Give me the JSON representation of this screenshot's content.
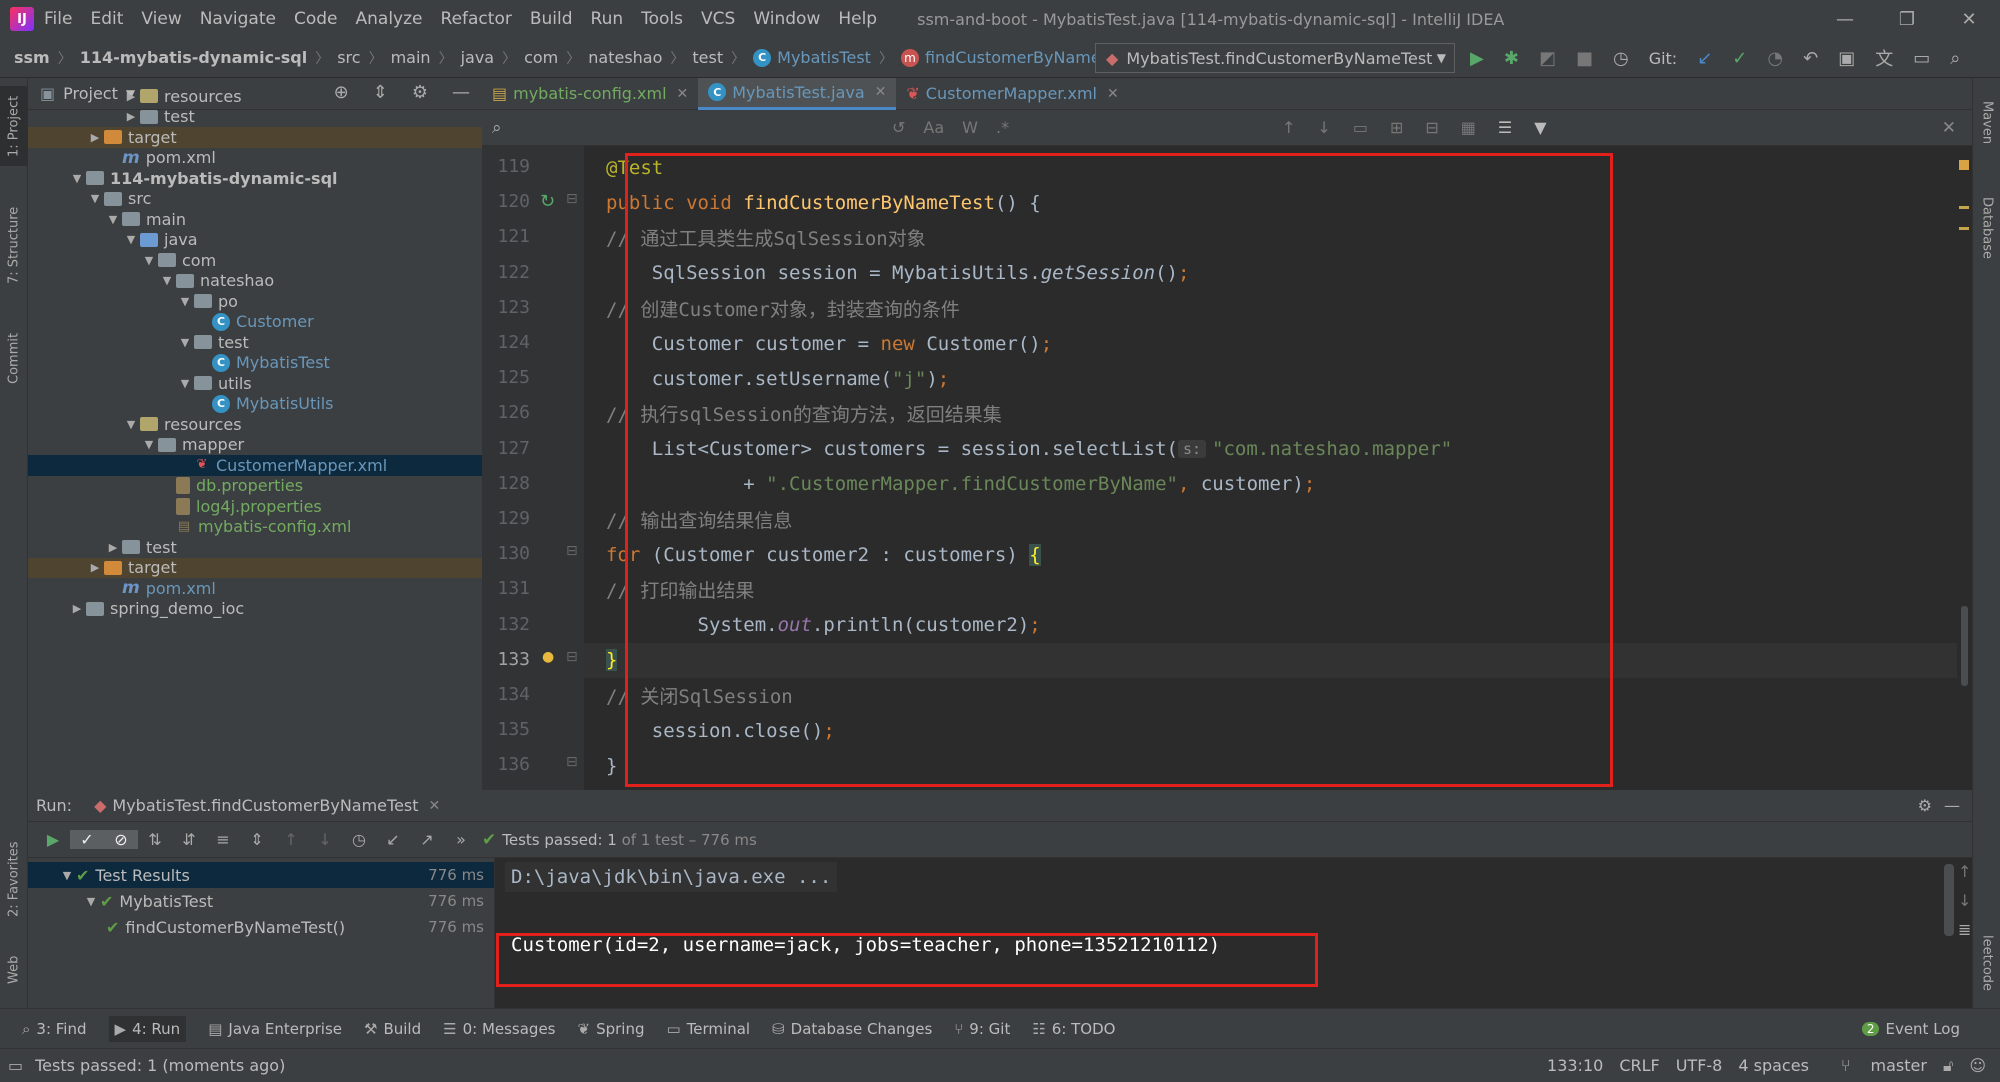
{
  "menubar": {
    "items": [
      "File",
      "Edit",
      "View",
      "Navigate",
      "Code",
      "Analyze",
      "Refactor",
      "Build",
      "Run",
      "Tools",
      "VCS",
      "Window",
      "Help"
    ],
    "title": "ssm-and-boot - MybatisTest.java [114-mybatis-dynamic-sql] - IntelliJ IDEA"
  },
  "breadcrumbs": [
    "ssm",
    "114-mybatis-dynamic-sql",
    "src",
    "main",
    "java",
    "com",
    "nateshao",
    "test",
    "MybatisTest",
    "findCustomerByNameTest"
  ],
  "run_config": "MybatisTest.findCustomerByNameTest",
  "git_label": "Git:",
  "left_tabs": {
    "project": "1: Project",
    "structure": "7: Structure",
    "commit": "Commit",
    "favorites": "2: Favorites",
    "web": "Web"
  },
  "right_tabs": {
    "maven": "Maven",
    "database": "Database",
    "leetcode": "leetcode"
  },
  "project_panel": {
    "title": "Project",
    "tree": [
      {
        "label": "resources",
        "type": "res",
        "indent": 3,
        "arrow": "right"
      },
      {
        "label": "test",
        "type": "pkg",
        "indent": 3,
        "arrow": "right"
      },
      {
        "label": "target",
        "type": "tgt",
        "indent": 1,
        "arrow": "right",
        "hl": true
      },
      {
        "label": "pom.xml",
        "type": "maven",
        "indent": 2,
        "arrow": ""
      },
      {
        "label": "114-mybatis-dynamic-sql",
        "type": "pkg",
        "indent": 0,
        "arrow": "down",
        "bold": true
      },
      {
        "label": "src",
        "type": "pkg",
        "indent": 1,
        "arrow": "down"
      },
      {
        "label": "main",
        "type": "pkg",
        "indent": 2,
        "arrow": "down"
      },
      {
        "label": "java",
        "type": "src",
        "indent": 3,
        "arrow": "down"
      },
      {
        "label": "com",
        "type": "pkg",
        "indent": 4,
        "arrow": "down"
      },
      {
        "label": "nateshao",
        "type": "pkg",
        "indent": 5,
        "arrow": "down"
      },
      {
        "label": "po",
        "type": "pkg",
        "indent": 6,
        "arrow": "down"
      },
      {
        "label": "Customer",
        "type": "class",
        "indent": 7,
        "arrow": ""
      },
      {
        "label": "test",
        "type": "pkg",
        "indent": 6,
        "arrow": "down"
      },
      {
        "label": "MybatisTest",
        "type": "class",
        "indent": 7,
        "arrow": ""
      },
      {
        "label": "utils",
        "type": "pkg",
        "indent": 6,
        "arrow": "down"
      },
      {
        "label": "MybatisUtils",
        "type": "class",
        "indent": 7,
        "arrow": ""
      },
      {
        "label": "resources",
        "type": "res",
        "indent": 3,
        "arrow": "down"
      },
      {
        "label": "mapper",
        "type": "pkg",
        "indent": 4,
        "arrow": "down"
      },
      {
        "label": "CustomerMapper.xml",
        "type": "xml",
        "indent": 6,
        "arrow": "",
        "sel": true
      },
      {
        "label": "db.properties",
        "type": "prop",
        "indent": 5,
        "arrow": ""
      },
      {
        "label": "log4j.properties",
        "type": "prop",
        "indent": 5,
        "arrow": ""
      },
      {
        "label": "mybatis-config.xml",
        "type": "xmlg",
        "indent": 5,
        "arrow": ""
      },
      {
        "label": "test",
        "type": "pkg",
        "indent": 2,
        "arrow": "right"
      },
      {
        "label": "target",
        "type": "tgt",
        "indent": 1,
        "arrow": "right",
        "hl": true
      },
      {
        "label": "pom.xml",
        "type": "maven",
        "indent": 2,
        "arrow": ""
      },
      {
        "label": "spring_demo_ioc",
        "type": "pkg",
        "indent": 0,
        "arrow": "right"
      }
    ]
  },
  "editor_tabs": [
    {
      "label": "mybatis-config.xml",
      "active": false
    },
    {
      "label": "MybatisTest.java",
      "active": true
    },
    {
      "label": "CustomerMapper.xml",
      "active": false
    }
  ],
  "findbar": {
    "aa": "Aa",
    "w": "W",
    "regex": ".*"
  },
  "code": {
    "current_line": 133,
    "lines": [
      {
        "n": 119,
        "html": "<span class='ann'>@Test</span>"
      },
      {
        "n": 120,
        "html": "<span class='kw'>public void </span><span class='fn'>findCustomerByNameTest</span>() {"
      },
      {
        "n": 121,
        "html": "    <span class='cmt'>// 通过工具类生成SqlSession对象</span>"
      },
      {
        "n": 122,
        "html": "    SqlSession session = MybatisUtils.<span class='it'>getSession</span>()<span class='kw'>;</span>"
      },
      {
        "n": 123,
        "html": "    <span class='cmt'>// 创建Customer对象，封装查询的条件</span>"
      },
      {
        "n": 124,
        "html": "    Customer customer = <span class='kw'>new </span>Customer()<span class='kw'>;</span>"
      },
      {
        "n": 125,
        "html": "    customer.setUsername(<span class='str'>\"j\"</span>)<span class='kw'>;</span>"
      },
      {
        "n": 126,
        "html": "    <span class='cmt'>// 执行sqlSession的查询方法，返回结果集</span>"
      },
      {
        "n": 127,
        "html": "    List&lt;Customer&gt; customers = session.selectList(<span class='hint'>s:</span><span class='str'>\"com.nateshao.mapper\"</span>"
      },
      {
        "n": 128,
        "html": "            + <span class='str'>\".CustomerMapper.findCustomerByName\"</span><span class='kw'>, </span>customer)<span class='kw'>;</span>"
      },
      {
        "n": 129,
        "html": "    <span class='cmt'>// 输出查询结果信息</span>"
      },
      {
        "n": 130,
        "html": "    <span class='kw'>for </span>(Customer customer2 : customers) <span style='background:#3b514d;color:#ffef28'>{</span>"
      },
      {
        "n": 131,
        "html": "        <span class='cmt'>// 打印输出结果</span>"
      },
      {
        "n": 132,
        "html": "        System.<span class='stat'>out</span>.println(customer2)<span class='kw'>;</span>"
      },
      {
        "n": 133,
        "html": "    <span style='background:#3b514d;color:#ffef28'>}</span>"
      },
      {
        "n": 134,
        "html": "    <span class='cmt'>// 关闭SqlSession</span>"
      },
      {
        "n": 135,
        "html": "    session.close()<span class='kw'>;</span>"
      },
      {
        "n": 136,
        "html": "}"
      }
    ]
  },
  "run_panel": {
    "label": "Run:",
    "tab": "MybatisTest.findCustomerByNameTest",
    "status_prefix": "Tests passed: ",
    "status_count": "1",
    "status_suffix": " of 1 test – 776 ms",
    "tree": [
      {
        "label": "Test Results",
        "time": "776 ms",
        "indent": 0,
        "sel": true
      },
      {
        "label": "MybatisTest",
        "time": "776 ms",
        "indent": 1
      },
      {
        "label": "findCustomerByNameTest()",
        "time": "776 ms",
        "indent": 2
      }
    ],
    "console_cmd": "D:\\java\\jdk\\bin\\java.exe ...",
    "console_output": "Customer(id=2, username=jack, jobs=teacher, phone=13521210112)"
  },
  "bottom_tools": [
    {
      "icon": "⌕",
      "label": "3: Find"
    },
    {
      "icon": "▶",
      "label": "4: Run"
    },
    {
      "icon": "▤",
      "label": "Java Enterprise"
    },
    {
      "icon": "⚒",
      "label": "Build"
    },
    {
      "icon": "☰",
      "label": "0: Messages"
    },
    {
      "icon": "❦",
      "label": "Spring"
    },
    {
      "icon": "▭",
      "label": "Terminal"
    },
    {
      "icon": "⛁",
      "label": "Database Changes"
    },
    {
      "icon": "⑂",
      "label": "9: Git"
    },
    {
      "icon": "☷",
      "label": "6: TODO"
    }
  ],
  "event_log": {
    "count": "2",
    "label": "Event Log"
  },
  "status": {
    "message": "Tests passed: 1 (moments ago)",
    "position": "133:10",
    "line_sep": "CRLF",
    "encoding": "UTF-8",
    "indent": "4 spaces",
    "branch": "master"
  },
  "colors": {
    "accent": "#4a88c7",
    "highlight_box": "#e2211c",
    "pass": "#5e9d46"
  }
}
